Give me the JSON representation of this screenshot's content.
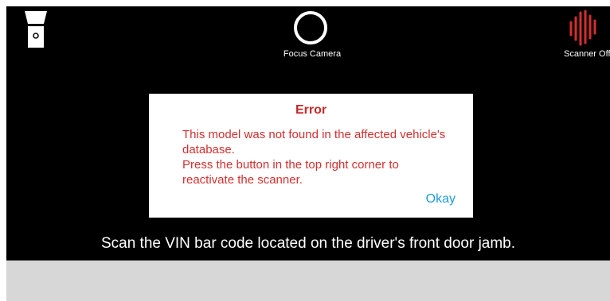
{
  "toolbar": {
    "flashlight_icon": "flashlight-icon",
    "focus_label": "Focus Camera",
    "scanner_label": "Scanner Off",
    "scanner_icon": "sound-wave-icon",
    "scanner_color": "#d32f2f"
  },
  "instruction": "Scan the VIN bar code located on the driver's front door jamb.",
  "dialog": {
    "title": "Error",
    "message": "This model was not found in the affected vehicle's database.\n Press the button in the top right corner to reactivate the scanner.",
    "okay_label": "Okay",
    "title_color": "#c62828",
    "accent_color": "#1e9bd7"
  }
}
